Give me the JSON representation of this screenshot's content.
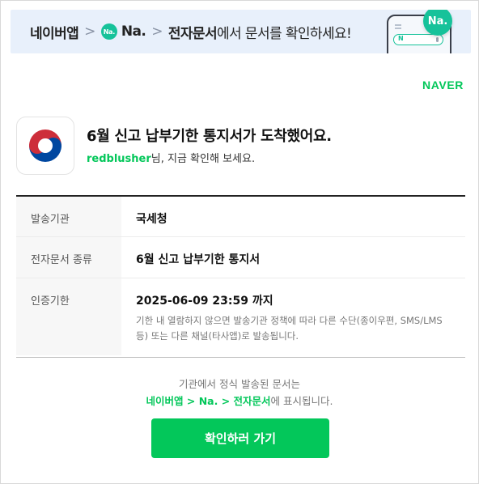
{
  "banner": {
    "app": "네이버앱",
    "sep": ">",
    "na_icon": "Na.",
    "na": "Na.",
    "doc": "전자문서",
    "rest": "에서 문서를 확인하세요!",
    "phone_badge": "Na.",
    "phone_search_icon": "N"
  },
  "brand": {
    "logo": "NAVER",
    "color": "#03c75a"
  },
  "message": {
    "title": "6월 신고 납부기한 통지서가 도착했어요.",
    "user": "redblusher",
    "sub_rest": "님, 지금 확인해 보세요."
  },
  "details": [
    {
      "label": "발송기관",
      "value": "국세청"
    },
    {
      "label": "전자문서 종류",
      "value": "6월 신고 납부기한 통지서"
    },
    {
      "label": "인증기한",
      "value": "2025-06-09 23:59 까지",
      "note": "기한 내 열람하지 않으면 발송기관 정책에 따라 다른 수단(종이우편, SMS/LMS 등) 또는 다른 채널(타사앱)로 발송됩니다."
    }
  ],
  "footer": {
    "line1": "기관에서 정식 발송된 문서는",
    "path": "네이버앱 > Na. > 전자문서",
    "line2_rest": "에 표시됩니다."
  },
  "cta": {
    "label": "확인하러 가기"
  }
}
